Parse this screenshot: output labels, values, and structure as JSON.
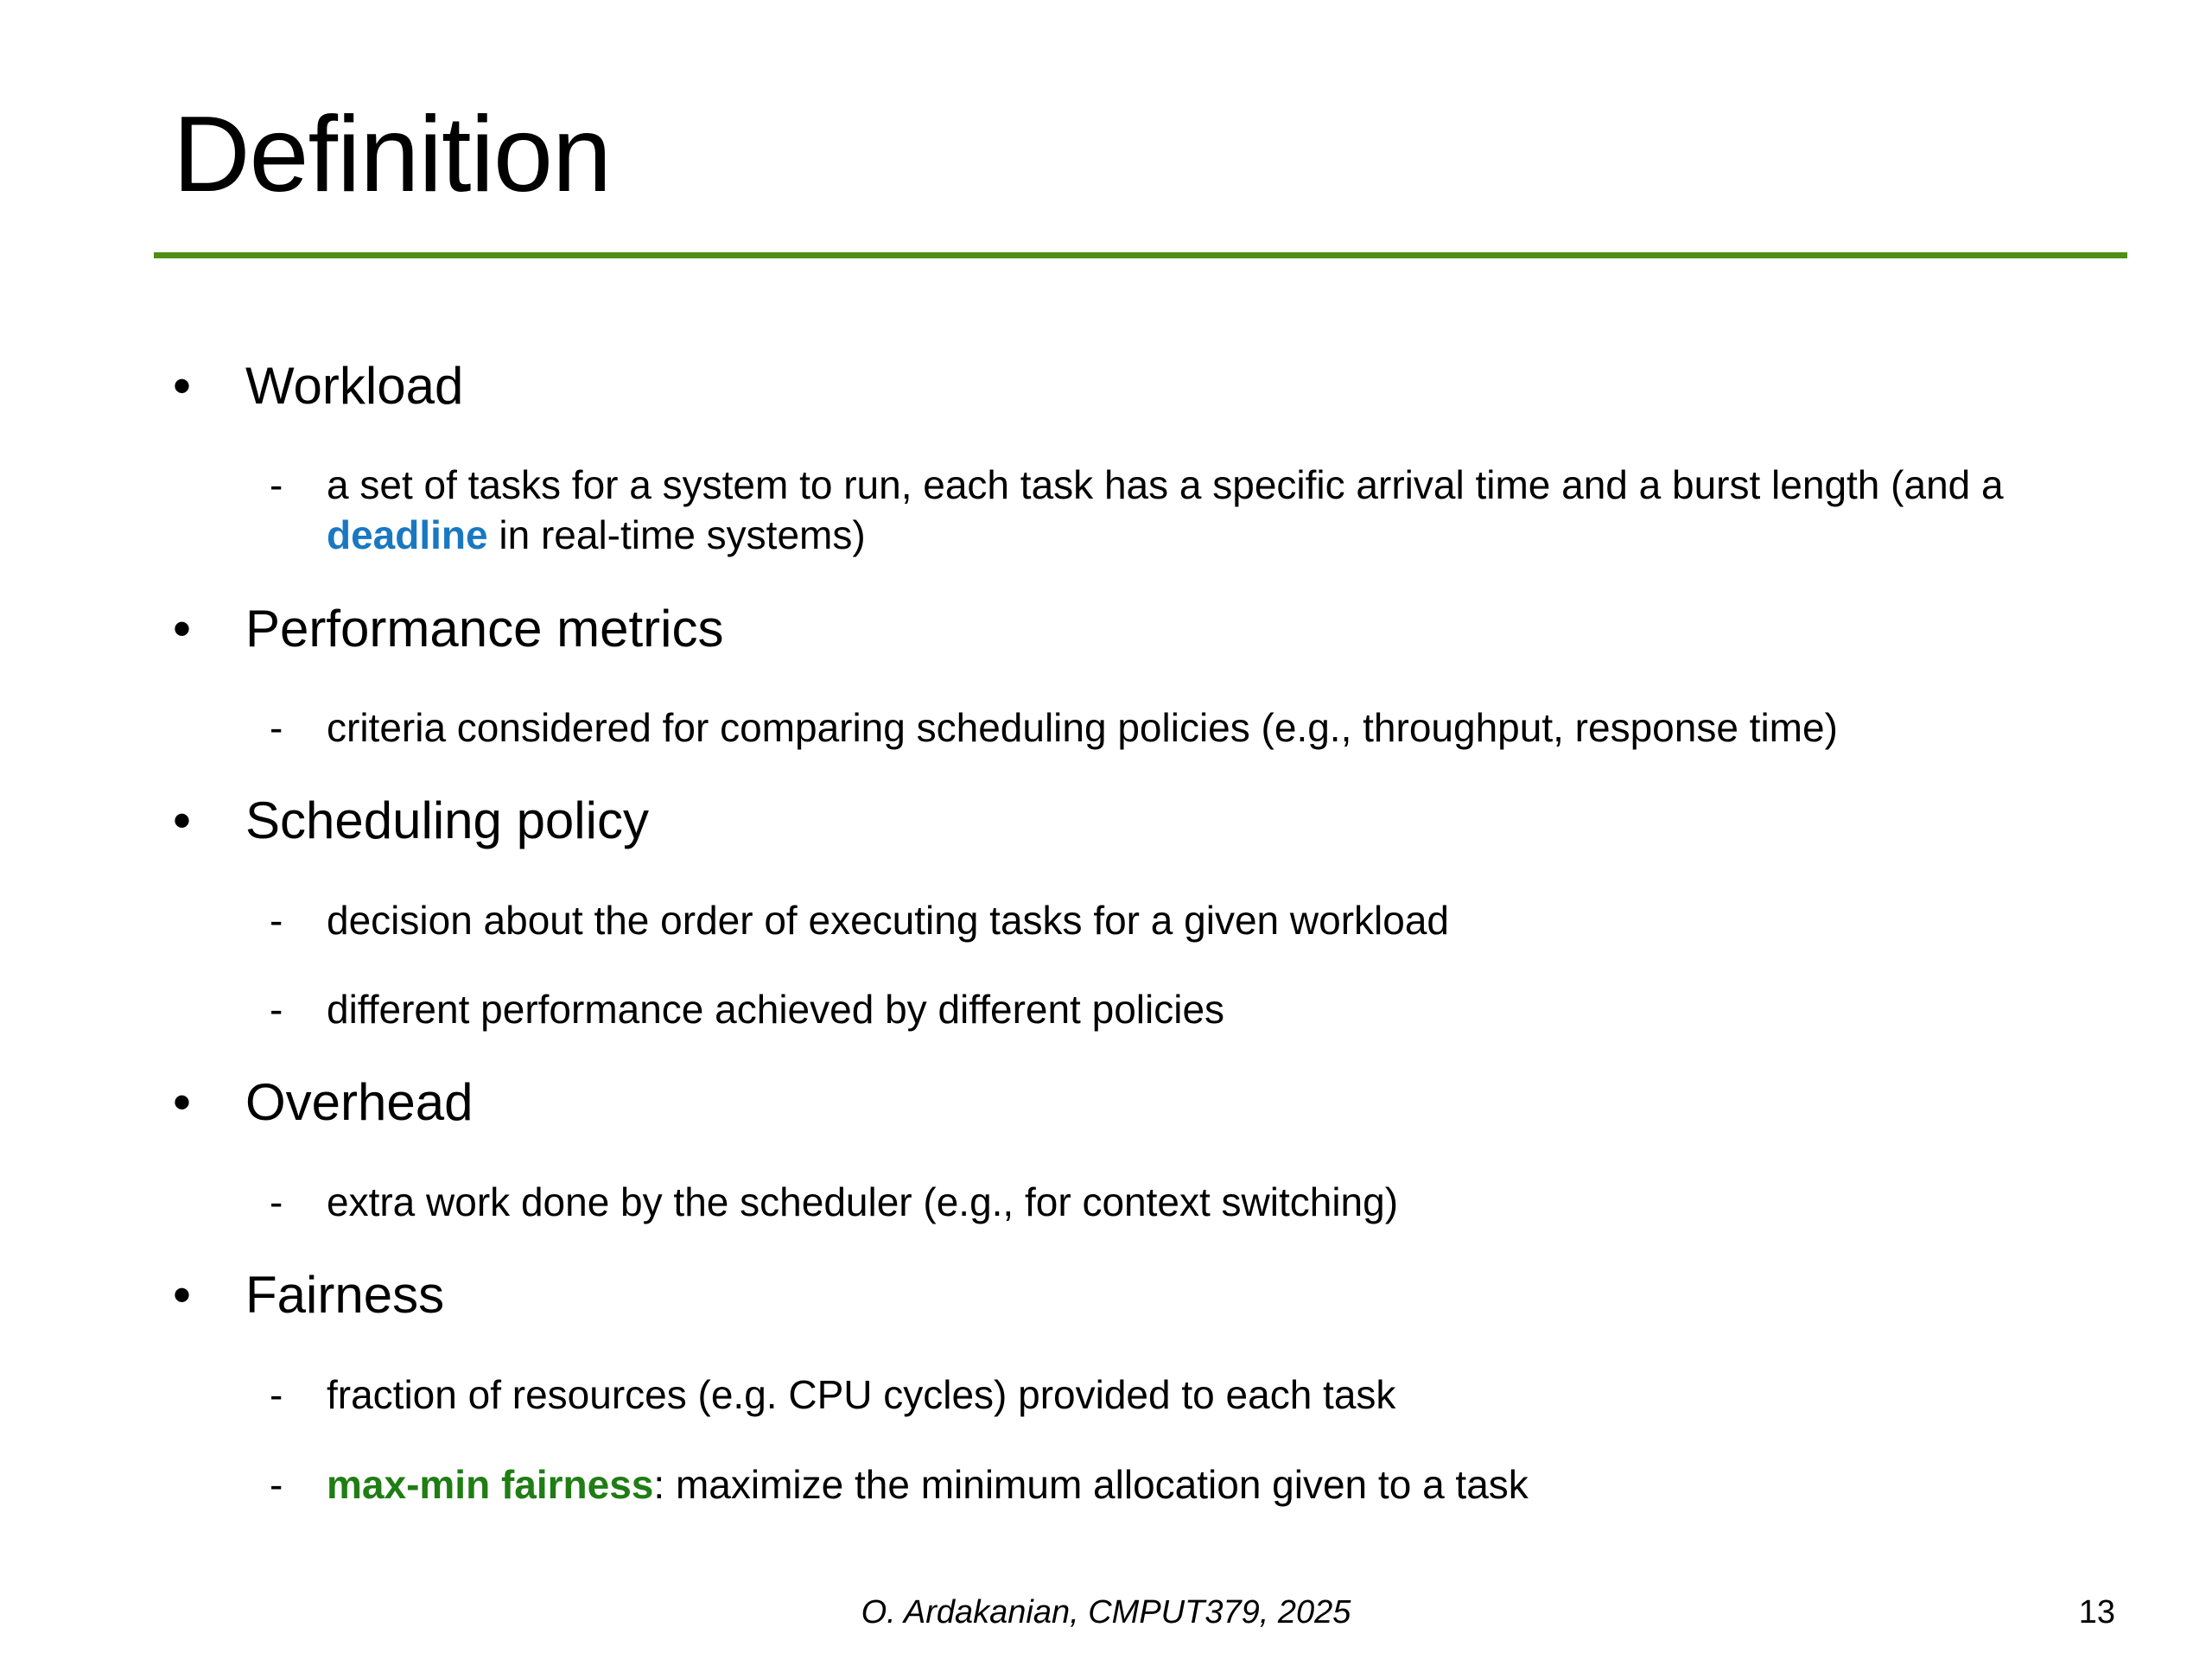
{
  "slide": {
    "title": "Definition",
    "accent_color": "#4e8f14"
  },
  "bullets": [
    {
      "label": "Workload",
      "subs": [
        {
          "parts": [
            {
              "text": "a set of tasks for a system to run, each task has a specific arrival time and a burst length (and a "
            },
            {
              "text": "deadline",
              "style": "blue"
            },
            {
              "text": " in real-time systems)"
            }
          ]
        }
      ]
    },
    {
      "label": "Performance metrics",
      "subs": [
        {
          "parts": [
            {
              "text": "criteria considered for comparing scheduling policies (e.g., throughput, response time)"
            }
          ]
        }
      ]
    },
    {
      "label": "Scheduling policy",
      "subs": [
        {
          "parts": [
            {
              "text": "decision about the order of executing tasks for a given workload"
            }
          ]
        },
        {
          "parts": [
            {
              "text": "different performance achieved by different policies"
            }
          ]
        }
      ]
    },
    {
      "label": "Overhead",
      "subs": [
        {
          "parts": [
            {
              "text": "extra work done by the scheduler (e.g., for context switching)"
            }
          ]
        }
      ]
    },
    {
      "label": "Fairness",
      "subs": [
        {
          "parts": [
            {
              "text": "fraction of resources (e.g. CPU cycles) provided to each task"
            }
          ]
        },
        {
          "parts": [
            {
              "text": "max-min fairness",
              "style": "green"
            },
            {
              "text": ": maximize the minimum allocation given to a task"
            }
          ]
        }
      ]
    }
  ],
  "bullet_marker": "•",
  "sub_marker": "-",
  "keyword_colors": {
    "blue": "#1a78c2",
    "green": "#1f7d14"
  },
  "footer": {
    "credit": "O. Ardakanian, CMPUT379, 2025",
    "page_number": "13"
  }
}
